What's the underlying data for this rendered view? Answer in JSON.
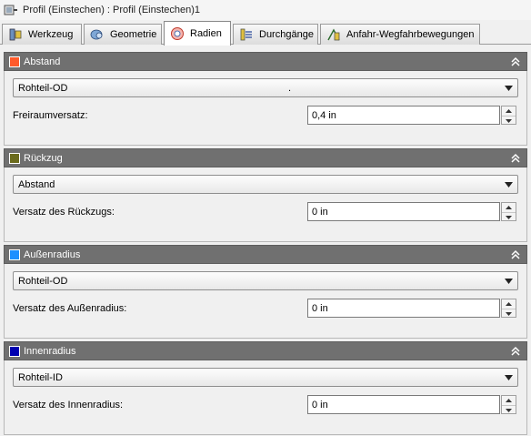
{
  "window": {
    "title": "Profil (Einstechen) : Profil (Einstechen)1"
  },
  "tabs": [
    {
      "label": "Werkzeug",
      "icon": "tool-icon"
    },
    {
      "label": "Geometrie",
      "icon": "geometry-icon"
    },
    {
      "label": "Radien",
      "icon": "radii-icon",
      "active": true
    },
    {
      "label": "Durchgänge",
      "icon": "passes-icon"
    },
    {
      "label": "Anfahr-Wegfahrbewegungen",
      "icon": "linking-icon"
    }
  ],
  "sections": [
    {
      "title": "Abstand",
      "swatch_color": "#ff5a2a",
      "dropdown_value": "Rohteil-OD",
      "dropdown_extra": ".",
      "field_label": "Freiraumversatz:",
      "field_value": "0,4 in"
    },
    {
      "title": "Rückzug",
      "swatch_color": "#6b6b1c",
      "dropdown_value": "Abstand",
      "dropdown_extra": "",
      "field_label": "Versatz des Rückzugs:",
      "field_value": "0 in"
    },
    {
      "title": "Außenradius",
      "swatch_color": "#1e90ff",
      "dropdown_value": "Rohteil-OD",
      "dropdown_extra": "",
      "field_label": "Versatz des Außenradius:",
      "field_value": "0 in"
    },
    {
      "title": "Innenradius",
      "swatch_color": "#0000b0",
      "dropdown_value": "Rohteil-ID",
      "dropdown_extra": "",
      "field_label": "Versatz des Innenradius:",
      "field_value": "0 in"
    }
  ]
}
